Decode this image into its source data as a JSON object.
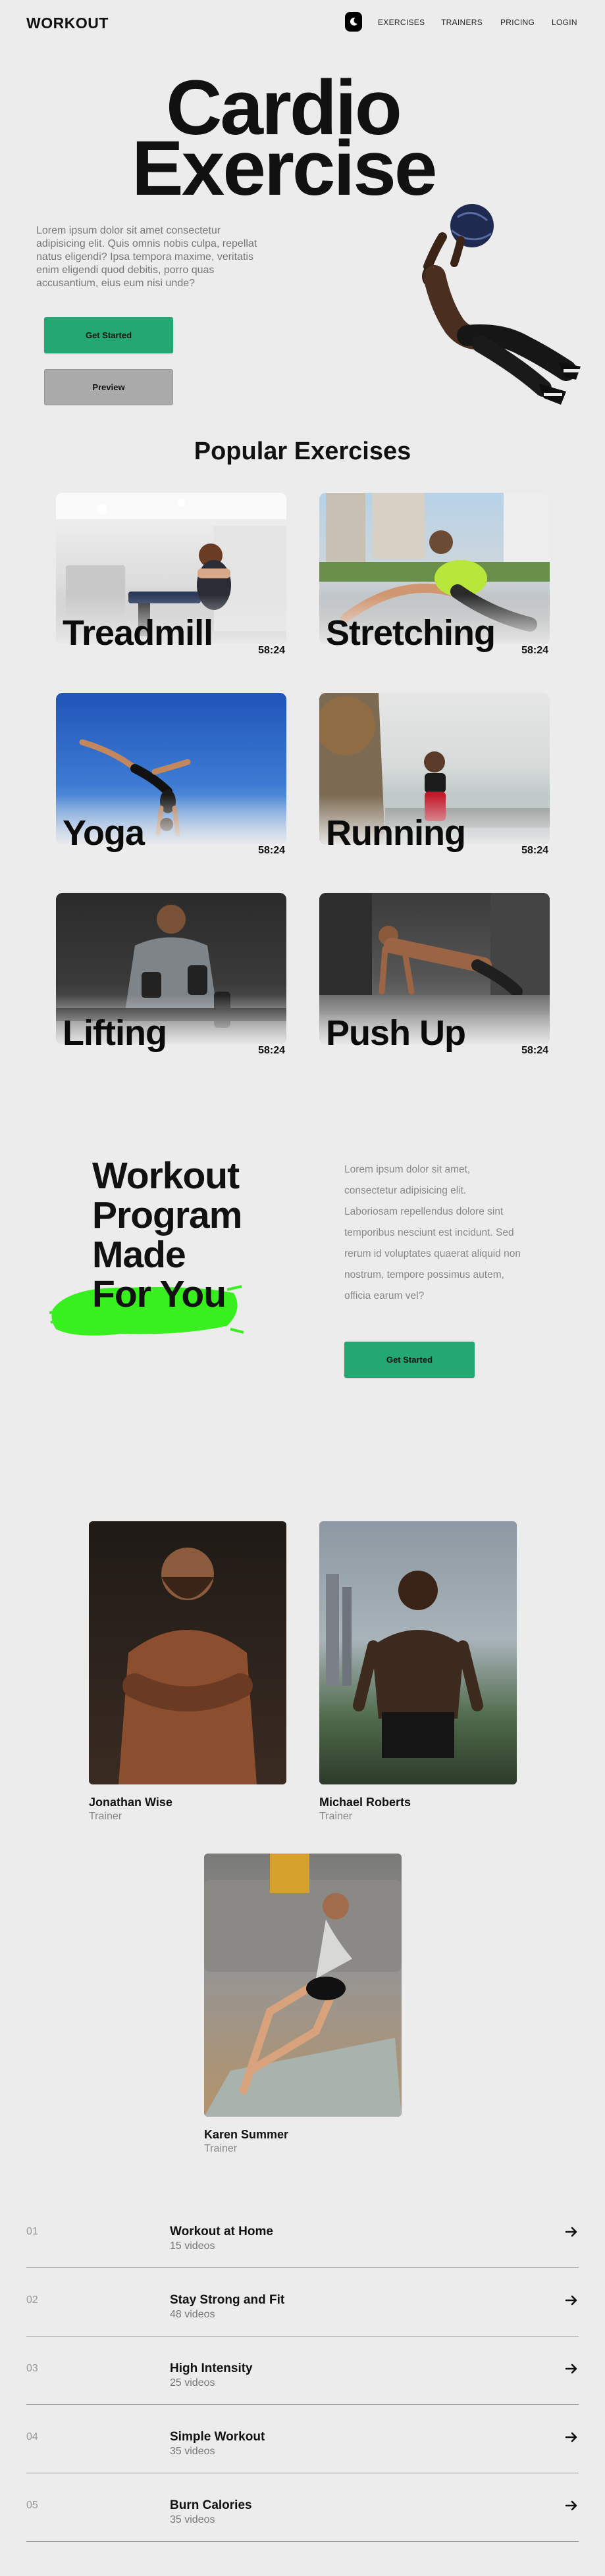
{
  "nav": {
    "logo": "WORKOUT",
    "links": [
      "EXERCISES",
      "TRAINERS",
      "PRICING",
      "LOGIN"
    ]
  },
  "hero": {
    "title_line1": "Cardio",
    "title_line2": "Exercise",
    "description": "Lorem ipsum dolor sit amet consectetur adipisicing elit. Quis omnis nobis culpa, repellat natus eligendi? Ipsa tempora maxime, veritatis enim eligendi quod debitis, porro quas accusantium, eius eum nisi unde?",
    "primary_button": "Get Started",
    "secondary_button": "Preview"
  },
  "popular": {
    "title": "Popular Exercises",
    "cards": [
      {
        "name": "Treadmill",
        "time": "58:24"
      },
      {
        "name": "Stretching",
        "time": "58:24"
      },
      {
        "name": "Yoga",
        "time": "58:24"
      },
      {
        "name": "Running",
        "time": "58:24"
      },
      {
        "name": "Lifting",
        "time": "58:24"
      },
      {
        "name": "Push Up",
        "time": "58:24"
      }
    ]
  },
  "program": {
    "line1": "Workout",
    "line2": "Program",
    "line3": "Made",
    "line4": "For You",
    "text": "Lorem ipsum dolor sit amet, consectetur adipisicing elit. Laboriosam repellendus dolore sint temporibus nesciunt est incidunt. Sed rerum id voluptates quaerat aliquid non nostrum, tempore possimus autem, officia earum vel?",
    "button": "Get Started",
    "highlight_color": "#39f01f"
  },
  "trainers": [
    {
      "name": "Jonathan Wise",
      "role": "Trainer"
    },
    {
      "name": "Michael Roberts",
      "role": "Trainer"
    },
    {
      "name": "Karen Summer",
      "role": "Trainer"
    }
  ],
  "programs_list": [
    {
      "num": "01",
      "title": "Workout at Home",
      "sub": "15 videos"
    },
    {
      "num": "02",
      "title": "Stay Strong and Fit",
      "sub": "48 videos"
    },
    {
      "num": "03",
      "title": "High Intensity",
      "sub": "25 videos"
    },
    {
      "num": "04",
      "title": "Simple Workout",
      "sub": "35 videos"
    },
    {
      "num": "05",
      "title": "Burn Calories",
      "sub": "35 videos"
    }
  ],
  "colors": {
    "accent": "#23a874",
    "background": "#ececec"
  }
}
